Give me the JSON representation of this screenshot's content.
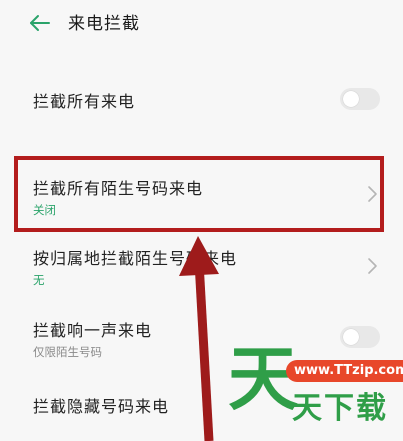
{
  "header": {
    "title": "来电拦截"
  },
  "settings": [
    {
      "title": "拦截所有来电",
      "subtitle": "",
      "control": "toggle",
      "toggle_on": false
    },
    {
      "title": "拦截所有陌生号码来电",
      "subtitle": "关闭",
      "control": "chevron"
    },
    {
      "title": "按归属地拦截陌生号码来电",
      "subtitle": "无",
      "control": "chevron"
    },
    {
      "title": "拦截响一声来电",
      "subtitle": "仅限陌生号码",
      "control": "toggle",
      "toggle_on": false
    },
    {
      "title": "拦截隐藏号码来电",
      "subtitle": "",
      "control": "none"
    }
  ],
  "watermark": {
    "logo_char": "天",
    "url": "www.TTzip.com",
    "text": "天下载"
  },
  "colors": {
    "accent": "#2aa36a",
    "highlight": "#b31d1d",
    "watermark_green": "#2f9e48",
    "watermark_badge": "#e8472a"
  },
  "icons": {
    "back": "arrow-left-icon",
    "chevron": "chevron-right-icon"
  }
}
